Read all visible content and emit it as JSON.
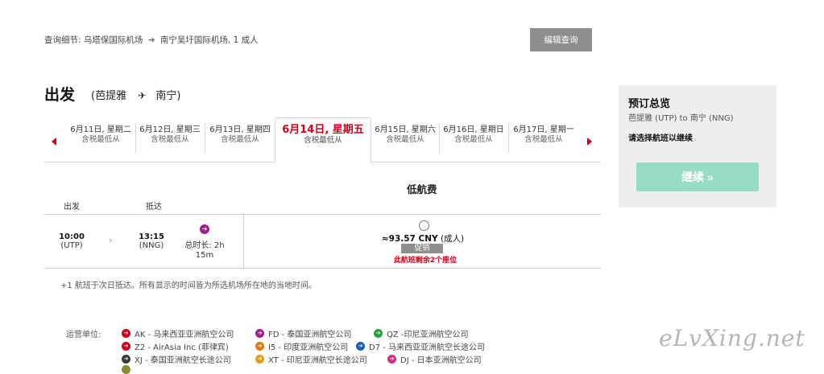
{
  "query": {
    "label": "查询细节:",
    "from": "乌塔保国际机场",
    "to": "南宁吴圩国际机场, 1 成人",
    "edit_button": "编辑查询"
  },
  "departure": {
    "title": "出发",
    "from": "(芭提雅",
    "to": "南宁)"
  },
  "dates": [
    {
      "date": "6月11日, 星期二",
      "price": "含税最低从"
    },
    {
      "date": "6月12日, 星期三",
      "price": "含税最低从"
    },
    {
      "date": "6月13日, 星期四",
      "price": "含税最低从"
    },
    {
      "date": "6月14日, 星期五",
      "price": "含税最低从"
    },
    {
      "date": "6月15日, 星期六",
      "price": "含税最低从"
    },
    {
      "date": "6月16日, 星期日",
      "price": "含税最低从"
    },
    {
      "date": "6月17日, 星期一",
      "price": "含税最低从"
    }
  ],
  "fare_header": "低航费",
  "columns": {
    "depart": "出发",
    "arrive": "抵达"
  },
  "flight": {
    "dep_time": "10:00",
    "dep_code": "(UTP)",
    "arr_time": "13:15",
    "arr_code": "(NNG)",
    "duration_line1": "总时长: 2h",
    "duration_line2": "15m",
    "price": "≈93.57 CNY",
    "price_suffix": "(成人)",
    "promo": "促销",
    "seats": "此航班剩余2个座位"
  },
  "note": "+1 航班于次日抵达。所有显示的时间皆为所选机场所在地的当地时间。",
  "operators": {
    "label": "运营单位:",
    "items": [
      {
        "name": "AK - 马来西亚亚洲航空公司",
        "color": "#d0021b"
      },
      {
        "name": "FD - 泰国亚洲航空公司",
        "color": "#a0208a"
      },
      {
        "name": "QZ -印尼亚洲航空公司",
        "color": "#2e9e3a"
      },
      {
        "name": "Z2 - AirAsia Inc (菲律宾)",
        "color": "#d0021b"
      },
      {
        "name": "I5 - 印度亚洲航空公司",
        "color": "#e07a10"
      },
      {
        "name": "D7 - 马来西亚亚洲航空长途公司",
        "color": "#1b5fb0"
      },
      {
        "name": "XJ - 泰国亚洲航空长途公司",
        "color": "#3a3a3a"
      },
      {
        "name": "XT - 印尼亚洲航空长途公司",
        "color": "#e0a010"
      },
      {
        "name": "DJ - 日本亚洲航空公司",
        "color": "#d0307a"
      }
    ]
  },
  "summary": {
    "title": "预订总览",
    "route": "芭提雅 (UTP) to 南宁 (NNG)",
    "select": "请选择航班以继续",
    "continue": "继续 »"
  },
  "watermark": "eLvXing.net"
}
